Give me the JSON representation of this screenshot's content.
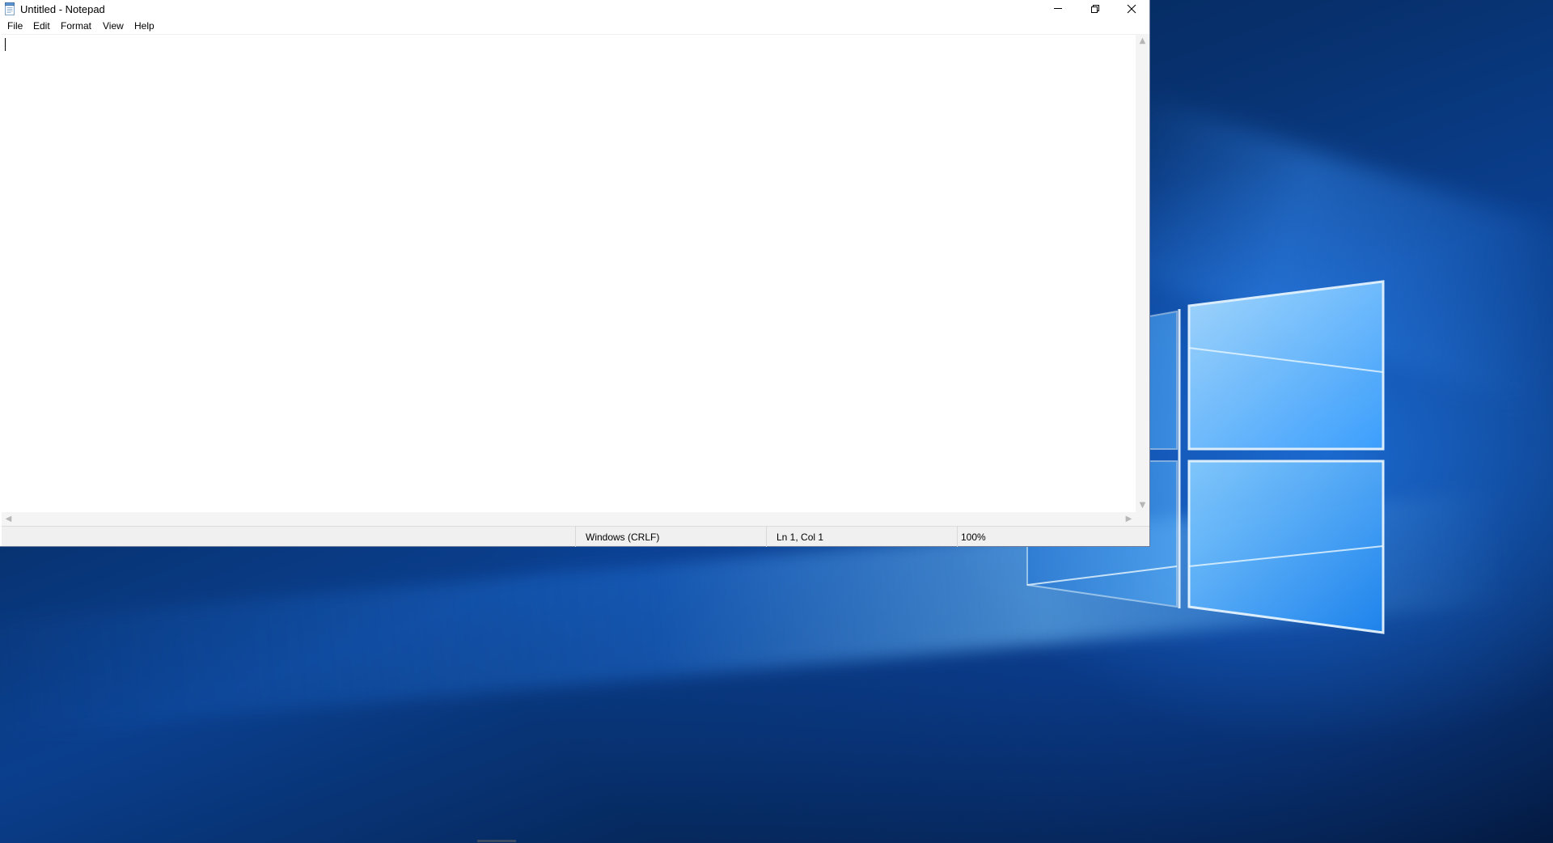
{
  "window": {
    "title": "Untitled - Notepad"
  },
  "menu": {
    "items": [
      "File",
      "Edit",
      "Format",
      "View",
      "Help"
    ]
  },
  "editor": {
    "text": ""
  },
  "status": {
    "line_endings": "Windows (CRLF)",
    "position": "Ln 1, Col 1",
    "zoom": "100%"
  },
  "icons": {
    "app": "notepad-icon",
    "minimize": "minimize-icon",
    "restore": "restore-icon",
    "close": "close-icon",
    "scroll_up": "chevron-up-icon",
    "scroll_down": "chevron-down-icon",
    "scroll_left": "chevron-left-icon",
    "scroll_right": "chevron-right-icon",
    "windows_logo": "windows-logo"
  },
  "colors": {
    "desktop_blue": "#0a3f8e",
    "logo_glow": "#7cc8ff",
    "window_border": "#6d7d99",
    "statusbar_bg": "#f0f0f0"
  }
}
